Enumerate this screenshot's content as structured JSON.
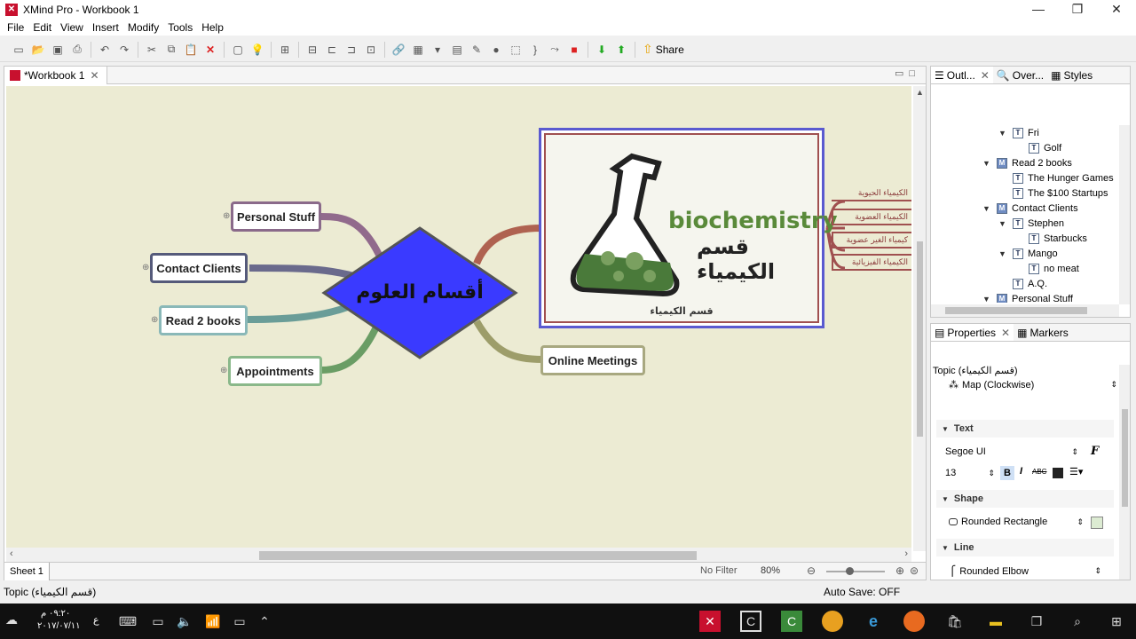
{
  "window": {
    "title": "XMind Pro - Workbook 1",
    "minimize": "—",
    "maximize": "❐",
    "close": "✕"
  },
  "menu": [
    "File",
    "Edit",
    "View",
    "Insert",
    "Modify",
    "Tools",
    "Help"
  ],
  "toolbar": {
    "share_label": "Share"
  },
  "editor": {
    "tab_label": "*Workbook 1"
  },
  "map": {
    "central": "أقسام العلوم",
    "image_topic": {
      "title_en": "biochemistry",
      "title_ar": "قسم الكيمياء",
      "caption": "قسم الكيمياء"
    },
    "left_topics": [
      "Personal Stuff",
      "Contact Clients",
      "Read 2 books",
      "Appointments"
    ],
    "right_topics": [
      "Online Meetings"
    ],
    "sub_topics": [
      "الكيمياء الحيوية",
      "الكيمياء العضوية",
      "كيمياء الغير عضوية",
      "الكيمياء الفيزيائية"
    ]
  },
  "sheet": {
    "name": "Sheet 1",
    "filter": "No Filter",
    "zoom": "80%"
  },
  "status": {
    "left": "Topic (قسم الكيمياء)",
    "autosave": "Auto Save: OFF"
  },
  "outline_panel": {
    "tabs": [
      "Outl...",
      "Over...",
      "Styles"
    ],
    "rows": [
      {
        "label": "Fri",
        "type": "T",
        "level": 4,
        "twisty": "open"
      },
      {
        "label": "Golf",
        "type": "T",
        "level": 5,
        "twisty": "none"
      },
      {
        "label": "Read 2 books",
        "type": "M",
        "level": 3,
        "twisty": "open"
      },
      {
        "label": "The Hunger Games",
        "type": "T",
        "level": 4,
        "twisty": "none"
      },
      {
        "label": "The $100 Startups",
        "type": "T",
        "level": 4,
        "twisty": "none"
      },
      {
        "label": "Contact Clients",
        "type": "M",
        "level": 3,
        "twisty": "open"
      },
      {
        "label": "Stephen",
        "type": "T",
        "level": 4,
        "twisty": "open"
      },
      {
        "label": "Starbucks",
        "type": "T",
        "level": 5,
        "twisty": "none"
      },
      {
        "label": "Mango",
        "type": "T",
        "level": 4,
        "twisty": "open"
      },
      {
        "label": "no meat",
        "type": "T",
        "level": 5,
        "twisty": "none"
      },
      {
        "label": "A.Q.",
        "type": "T",
        "level": 4,
        "twisty": "none"
      },
      {
        "label": "Personal Stuff",
        "type": "M",
        "level": 3,
        "twisty": "open"
      }
    ]
  },
  "properties_panel": {
    "tabs": [
      "Properties",
      "Markers"
    ],
    "title": "Topic (قسم الكيمياء)",
    "structure": "Map (Clockwise)",
    "text_section": "Text",
    "font": "Segoe UI",
    "font_size": "13",
    "shape_section": "Shape",
    "shape": "Rounded Rectangle",
    "line_section": "Line",
    "line": "Rounded Elbow"
  },
  "taskbar": {
    "time": "٠٩:٢٠ م",
    "date": "٢٠١٧/٠٧/١١",
    "lang": "ع"
  },
  "colors": {
    "canvas": "#ecebd3",
    "diamond": "#3a3aff",
    "accent": "#c8102e"
  }
}
